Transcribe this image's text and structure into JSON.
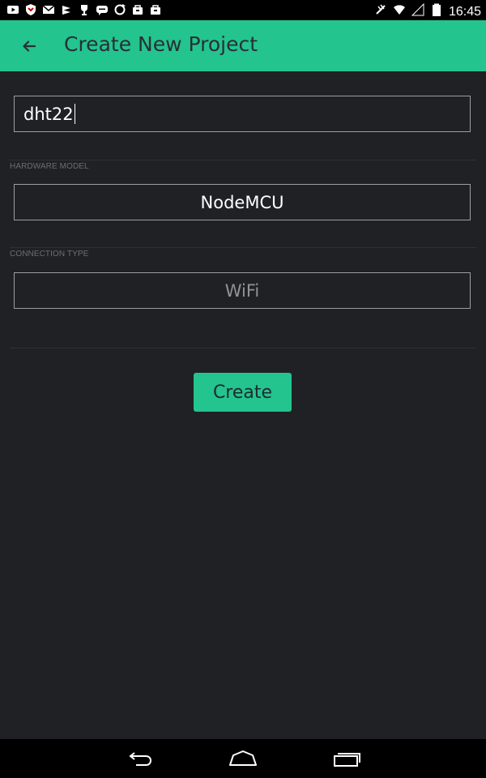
{
  "status_bar": {
    "time": "16:45",
    "notification_icons": [
      "youtube-icon",
      "shield-icon",
      "gmail-icon",
      "stack-icon",
      "trophy-icon",
      "chat-icon",
      "sync-icon",
      "bag-icon",
      "bag-icon"
    ],
    "status_icons": [
      "wifi-off-icon",
      "wifi-icon",
      "signal-icon",
      "battery-icon"
    ]
  },
  "app_bar": {
    "title": "Create New Project",
    "back_icon": "arrow-left-icon",
    "background": "#23c48e"
  },
  "form": {
    "project_name_value": "dht22",
    "hardware_model_label": "HARDWARE MODEL",
    "hardware_model_value": "NodeMCU",
    "connection_type_label": "CONNECTION TYPE",
    "connection_type_value": "WiFi",
    "create_label": "Create"
  },
  "nav_bar": {
    "buttons": [
      "back-nav-icon",
      "home-nav-icon",
      "recents-nav-icon"
    ]
  }
}
